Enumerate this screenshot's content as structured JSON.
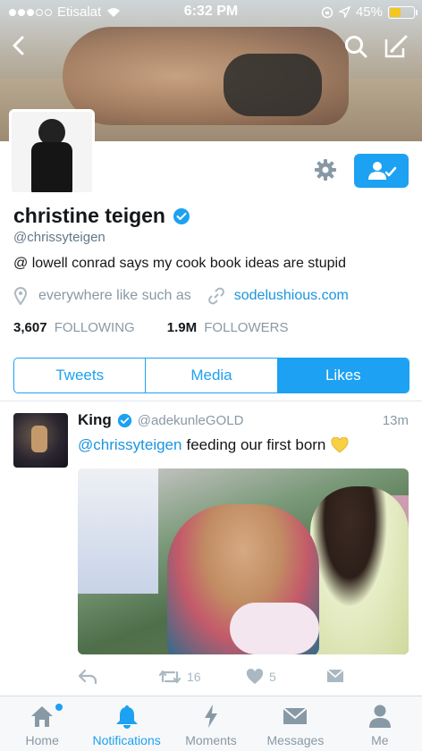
{
  "status_bar": {
    "carrier": "Etisalat",
    "time": "6:32 PM",
    "battery": "45%",
    "battery_level": 0.45
  },
  "profile": {
    "name": "christine teigen",
    "handle": "@chrissyteigen",
    "bio": "@ lowell conrad says my cook book ideas are stupid",
    "location": "everywhere like such as",
    "url": "sodelushious.com",
    "following_count": "3,607",
    "following_label": "FOLLOWING",
    "followers_count": "1.9M",
    "followers_label": "FOLLOWERS"
  },
  "tabs": [
    {
      "label": "Tweets",
      "active": false
    },
    {
      "label": "Media",
      "active": false
    },
    {
      "label": "Likes",
      "active": true
    }
  ],
  "tweet": {
    "name": "King",
    "handle": "@adekunleGOLD",
    "time": "13m",
    "mention": "@chrissyteigen",
    "text": "feeding our first born",
    "retweets": "16",
    "likes": "5"
  },
  "bottom_nav": [
    {
      "label": "Home",
      "icon": "home-icon"
    },
    {
      "label": "Notifications",
      "icon": "bell-icon"
    },
    {
      "label": "Moments",
      "icon": "lightning-icon"
    },
    {
      "label": "Messages",
      "icon": "envelope-icon"
    },
    {
      "label": "Me",
      "icon": "person-icon"
    }
  ],
  "colors": {
    "accent": "#1da1f2",
    "link": "#1b95e0",
    "muted": "#8899a6",
    "battery": "#f3c621"
  }
}
